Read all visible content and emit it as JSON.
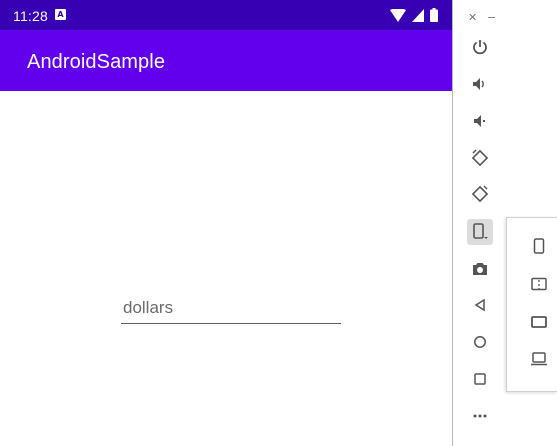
{
  "status_bar": {
    "time": "11:28",
    "notification_icon": "A",
    "icons": [
      "wifi-icon",
      "signal-icon",
      "battery-icon"
    ],
    "background": "#3700b3"
  },
  "app_bar": {
    "title": "AndroidSample",
    "background": "#6200ee"
  },
  "form": {
    "amount_input": {
      "value": "",
      "placeholder": "dollars"
    }
  },
  "emulator_toolbar": {
    "window_controls": [
      "close-icon",
      "minimize-icon"
    ],
    "buttons": [
      "power-icon",
      "volume-up-icon",
      "volume-down-icon",
      "rotate-left-icon",
      "rotate-right-icon",
      "fold-device-icon",
      "camera-icon",
      "back-icon",
      "home-icon",
      "overview-icon",
      "more-icon"
    ],
    "active_button": "fold-device-icon"
  },
  "posture_flyout": {
    "options": [
      "phone-posture-icon",
      "half-open-posture-icon",
      "tablet-posture-icon",
      "laptop-posture-icon"
    ]
  }
}
